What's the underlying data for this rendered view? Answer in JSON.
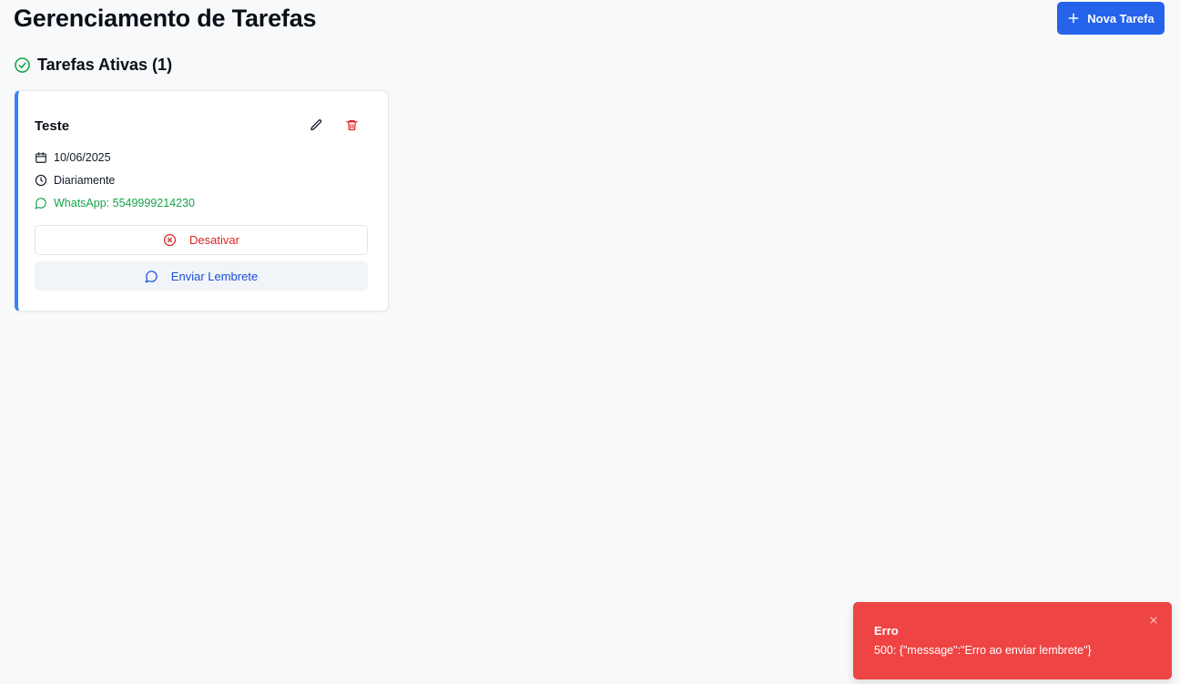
{
  "header": {
    "title": "Gerenciamento de Tarefas",
    "new_task_label": "Nova Tarefa",
    "new_task_icon": "plus-icon"
  },
  "section": {
    "title": "Tarefas Ativas (1)",
    "icon": "check-circle-icon"
  },
  "tasks": [
    {
      "title": "Teste",
      "date": "10/06/2025",
      "frequency": "Diariamente",
      "whatsapp": "WhatsApp: 5549999214230",
      "deactivate_label": "Desativar",
      "send_reminder_label": "Enviar Lembrete",
      "accent_color": "#3b82f6"
    }
  ],
  "toast": {
    "title": "Erro",
    "message": "500: {\"message\":\"Erro ao enviar lembrete\"}",
    "color": "#ef4444"
  },
  "colors": {
    "primary": "#2563eb",
    "success": "#16a34a",
    "danger": "#dc2626",
    "background": "#f8f9fb"
  }
}
